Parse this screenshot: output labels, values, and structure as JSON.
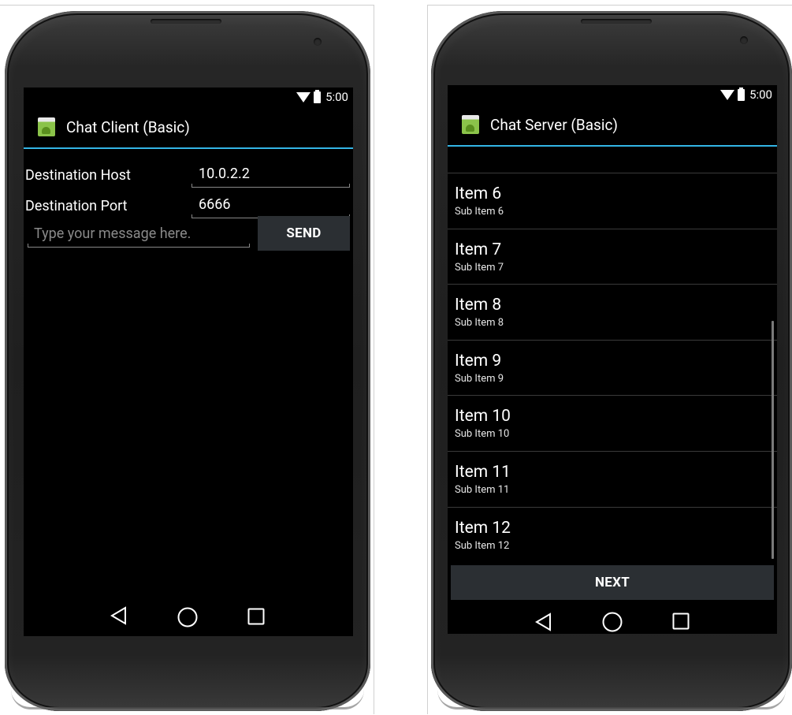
{
  "client": {
    "status_time": "5:00",
    "title": "Chat Client (Basic)",
    "host_label": "Destination Host",
    "host_value": "10.0.2.2",
    "port_label": "Destination Port",
    "port_value": "6666",
    "message_placeholder": "Type your message here.",
    "send_label": "SEND"
  },
  "server": {
    "status_time": "5:00",
    "title": "Chat Server (Basic)",
    "items": [
      {
        "title": "Item 6",
        "subtitle": "Sub Item 6"
      },
      {
        "title": "Item 7",
        "subtitle": "Sub Item 7"
      },
      {
        "title": "Item 8",
        "subtitle": "Sub Item 8"
      },
      {
        "title": "Item 9",
        "subtitle": "Sub Item 9"
      },
      {
        "title": "Item 10",
        "subtitle": "Sub Item 10"
      },
      {
        "title": "Item 11",
        "subtitle": "Sub Item 11"
      },
      {
        "title": "Item 12",
        "subtitle": "Sub Item 12"
      }
    ],
    "next_label": "NEXT"
  },
  "icons": [
    "wifi-icon",
    "battery-icon",
    "app-icon",
    "back-icon",
    "home-icon",
    "recent-apps-icon"
  ],
  "colors": {
    "accent": "#33b5e5",
    "button": "#2b2f33",
    "screen": "#000000"
  }
}
